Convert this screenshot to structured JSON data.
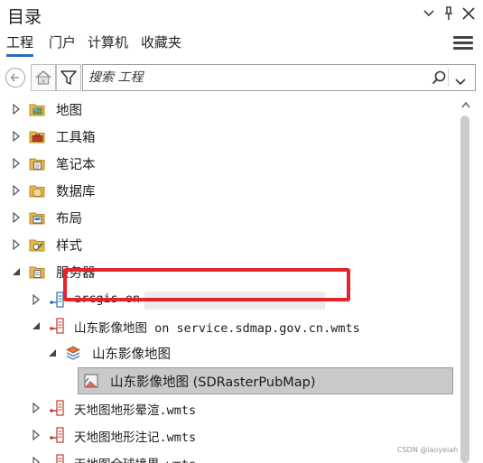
{
  "window": {
    "title": "目录"
  },
  "tabs": [
    {
      "label": "工程",
      "active": true
    },
    {
      "label": "门户",
      "active": false
    },
    {
      "label": "计算机",
      "active": false
    },
    {
      "label": "收藏夹",
      "active": false
    }
  ],
  "search": {
    "placeholder": "搜索 工程"
  },
  "tree": {
    "items": [
      {
        "label": "地图",
        "icon": "map-folder-icon",
        "expanded": false
      },
      {
        "label": "工具箱",
        "icon": "toolbox-folder-icon",
        "expanded": false
      },
      {
        "label": "笔记本",
        "icon": "notebook-folder-icon",
        "expanded": false
      },
      {
        "label": "数据库",
        "icon": "database-folder-icon",
        "expanded": false
      },
      {
        "label": "布局",
        "icon": "layout-folder-icon",
        "expanded": false
      },
      {
        "label": "样式",
        "icon": "style-folder-icon",
        "expanded": false
      },
      {
        "label": "服务器",
        "icon": "server-folder-icon",
        "expanded": true
      }
    ],
    "servers": [
      {
        "label": "arcgis on",
        "icon": "arcgis-server-icon",
        "expanded": false
      },
      {
        "label": "山东影像地图 on service.sdmap.gov.cn.wmts",
        "icon": "wmts-server-icon",
        "expanded": true
      },
      {
        "label": "天地图地形晕渲.wmts",
        "icon": "wmts-server-icon",
        "expanded": false
      },
      {
        "label": "天地图地形注记.wmts",
        "icon": "wmts-server-icon",
        "expanded": false
      },
      {
        "label": "天地图全球境界.wmts",
        "icon": "wmts-server-icon",
        "expanded": false
      }
    ],
    "layer_group": {
      "label": "山东影像地图",
      "icon": "layer-group-icon"
    },
    "selected_layer": {
      "label": "山东影像地图 (SDRasterPubMap)",
      "icon": "raster-layer-icon"
    }
  },
  "watermark": "CSDN @laoyeiah",
  "colors": {
    "accent": "#2a6ebb",
    "highlight": "#e3242b",
    "selection": "#c9c9c9",
    "folder": "#e8b84a"
  }
}
